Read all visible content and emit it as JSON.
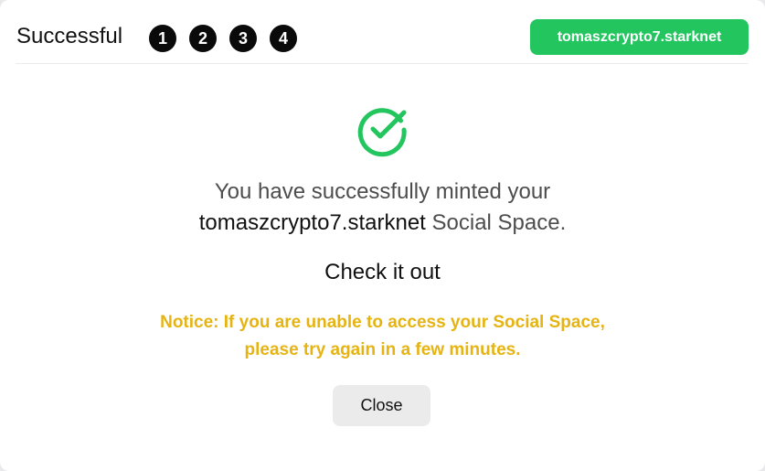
{
  "header": {
    "title": "Successful",
    "steps": [
      "1",
      "2",
      "3",
      "4"
    ],
    "account_label": "tomaszcrypto7.starknet"
  },
  "icons": {
    "success": "check-circle-icon"
  },
  "colors": {
    "accent_green": "#22c55e",
    "notice_yellow": "#e6b412"
  },
  "body": {
    "message_prefix": "You have successfully minted your",
    "domain_name": "tomaszcrypto7.starknet",
    "message_suffix": " Social Space.",
    "check_out": "Check it out",
    "notice_line1": "Notice: If you are unable to access your Social Space,",
    "notice_line2": "please try again in a few minutes."
  },
  "actions": {
    "close_label": "Close"
  }
}
